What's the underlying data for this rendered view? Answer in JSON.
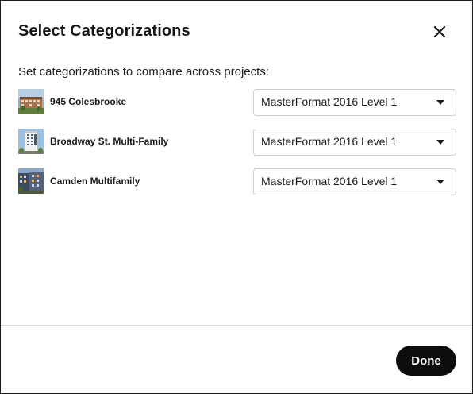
{
  "dialog": {
    "title": "Select Categorizations",
    "close_icon": "close-icon",
    "subtitle": "Set categorizations to compare across projects:",
    "done_label": "Done"
  },
  "projects": [
    {
      "name": "945 Colesbrooke",
      "categorization": "MasterFormat 2016 Level 1",
      "thumbnail_icon": "building-photo"
    },
    {
      "name": "Broadway St. Multi-Family",
      "categorization": "MasterFormat 2016 Level 1",
      "thumbnail_icon": "building-photo"
    },
    {
      "name": "Camden Multifamily",
      "categorization": "MasterFormat 2016 Level 1",
      "thumbnail_icon": "building-photo"
    }
  ],
  "colors": {
    "done_button_bg": "#0d0d0d",
    "done_button_text": "#ffffff",
    "select_border": "#cfcfcf"
  }
}
